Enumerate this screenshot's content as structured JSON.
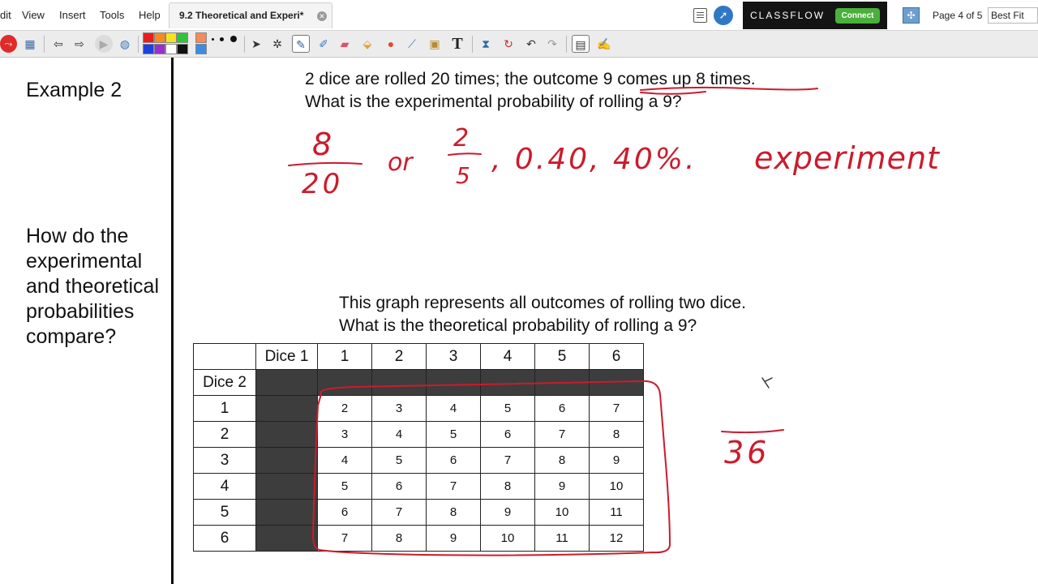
{
  "menu": {
    "items": [
      "dit",
      "View",
      "Insert",
      "Tools",
      "Help"
    ]
  },
  "document": {
    "tab_title": "9.2 Theoretical and Experi*",
    "close_glyph": "✕"
  },
  "classflow": {
    "brand": "CLASSFLOW",
    "connect_label": "Connect"
  },
  "pager": {
    "page_info": "Page 4 of 5",
    "zoom_value": "Best Fit"
  },
  "icons": {
    "toolbar": [
      "stop-icon",
      "page-settings-icon",
      "previous-page-icon",
      "next-page-icon",
      "play-icon",
      "web-browser-icon",
      "color-palette",
      "pen-size-dots",
      "select-icon",
      "magic-wand-icon",
      "pen-icon",
      "highlighter-icon",
      "eraser-icon",
      "fill-icon",
      "shape-icon",
      "connector-icon",
      "screen-capture-icon",
      "text-icon",
      "clear-icon",
      "reset-icon",
      "undo-icon",
      "redo-icon",
      "notes-icon",
      "handwriting-icon"
    ]
  },
  "colors": {
    "palette": [
      "#e81e1e",
      "#f58a1f",
      "#f5e31e",
      "#2fc43a",
      "#1f3fe0",
      "#9a2fd1",
      "#ffffff",
      "#111111"
    ],
    "ink_red": "#cc1b2c",
    "grid_dark": "#3d3d3d"
  },
  "page": {
    "example_label": "Example 2",
    "compare_question": [
      "How do the",
      "experimental",
      "and theoretical",
      "probabilities",
      "compare?"
    ],
    "problem_line1": "2 dice are rolled 20 times; the outcome 9  comes up 8 times.",
    "problem_line2": "What is the experimental probability of rolling a 9?",
    "graph_line1": "This graph represents all outcomes of rolling two dice.",
    "graph_line2": "What is the theoretical probability of rolling a 9?"
  },
  "dice_table": {
    "corner_label": "",
    "dice1_label": "Dice 1",
    "dice2_label": "Dice 2",
    "dice1_values": [
      "1",
      "2",
      "3",
      "4",
      "5",
      "6"
    ],
    "rows": [
      {
        "label": "1",
        "sums": [
          "2",
          "3",
          "4",
          "5",
          "6",
          "7"
        ]
      },
      {
        "label": "2",
        "sums": [
          "3",
          "4",
          "5",
          "6",
          "7",
          "8"
        ]
      },
      {
        "label": "3",
        "sums": [
          "4",
          "5",
          "6",
          "7",
          "8",
          "9"
        ]
      },
      {
        "label": "4",
        "sums": [
          "5",
          "6",
          "7",
          "8",
          "9",
          "10"
        ]
      },
      {
        "label": "5",
        "sums": [
          "6",
          "7",
          "8",
          "9",
          "10",
          "11"
        ]
      },
      {
        "label": "6",
        "sums": [
          "7",
          "8",
          "9",
          "10",
          "11",
          "12"
        ]
      }
    ]
  },
  "handwriting": {
    "numerator": "8",
    "denominator": "20",
    "or_word": "or",
    "alt_numerator": "2",
    "alt_denominator": "5",
    "decimal": ", 0.40, 40%.",
    "label": "experiment",
    "theoretical_denominator": "36"
  }
}
